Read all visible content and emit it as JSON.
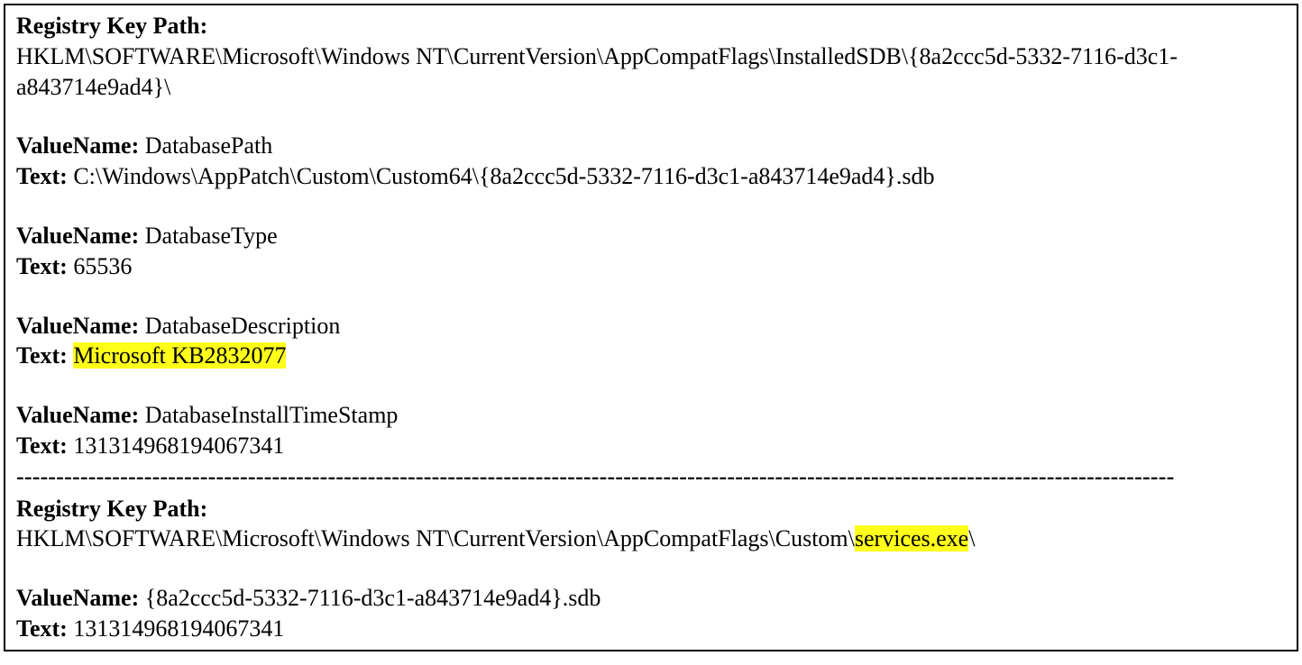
{
  "labels": {
    "registry_key_path": "Registry Key Path:",
    "value_name": "ValueName:",
    "text": "Text:"
  },
  "section1": {
    "key_path": "HKLM\\SOFTWARE\\Microsoft\\Windows NT\\CurrentVersion\\AppCompatFlags\\InstalledSDB\\{8a2ccc5d-5332-7116-d3c1-a843714e9ad4}\\",
    "values": {
      "v1_name": "DatabasePath",
      "v1_text": "C:\\Windows\\AppPatch\\Custom\\Custom64\\{8a2ccc5d-5332-7116-d3c1-a843714e9ad4}.sdb",
      "v2_name": "DatabaseType",
      "v2_text": "65536",
      "v3_name": "DatabaseDescription",
      "v3_text_highlight": "Microsoft KB2832077",
      "v4_name": "DatabaseInstallTimeStamp",
      "v4_text": "131314968194067341"
    }
  },
  "separator": "-------------------------------------------------------------------------------------------------------------------------------------------------",
  "section2": {
    "key_path_prefix": "HKLM\\SOFTWARE\\Microsoft\\Windows NT\\CurrentVersion\\AppCompatFlags\\Custom\\",
    "key_path_highlight": "services.exe",
    "key_path_suffix": "\\",
    "v1_name": "{8a2ccc5d-5332-7116-d3c1-a843714e9ad4}.sdb",
    "v1_text": "131314968194067341"
  }
}
